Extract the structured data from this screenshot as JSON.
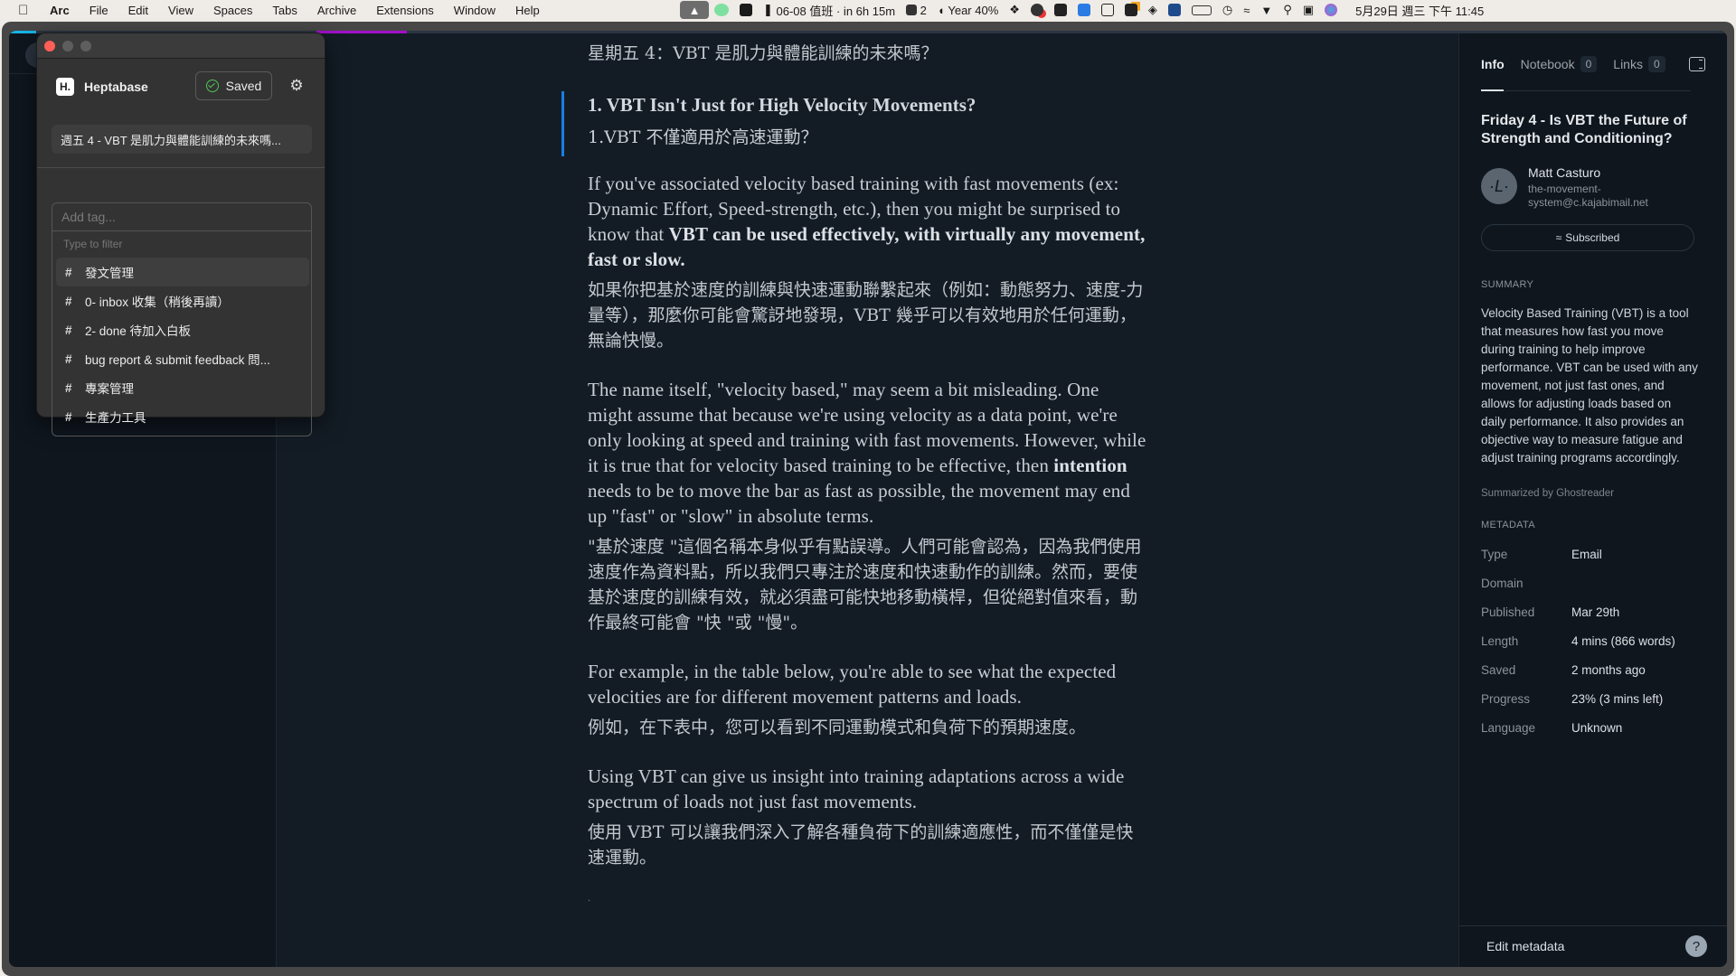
{
  "menubar": {
    "apple_icon": "apple-logo-icon",
    "app_name": "Arc",
    "menus": [
      "File",
      "Edit",
      "View",
      "Spaces",
      "Tabs",
      "Archive",
      "Extensions",
      "Window",
      "Help"
    ],
    "tray": {
      "event": "06-08 值班 · in 6h 15m",
      "todo_count": "2",
      "year_progress": "Year 40%",
      "datetime": "5月29日 週三 下午 11:45"
    }
  },
  "popup": {
    "app_name": "Heptabase",
    "logo_text": "H.",
    "saved_label": "Saved",
    "doc_title": "週五 4 - VBT 是肌力與體能訓練的未來嗎...",
    "tag_input_placeholder": "Add tag...",
    "filter_hint": "Type to filter",
    "tags": [
      "發文管理",
      "0- inbox 收集（稍後再讀）",
      "2- done 待加入白板",
      "bug report & submit feedback 問...",
      "專案管理",
      "生產力工具"
    ]
  },
  "article": {
    "title_zh": "星期五 4：VBT 是肌力與體能訓練的未來嗎？",
    "heading_en": "1. VBT Isn't Just for High Velocity Movements?",
    "heading_zh": "1.VBT 不僅適用於高速運動？",
    "p1_en_a": "If you've associated velocity based training with fast movements (ex: Dynamic Effort, Speed-strength, etc.), then you might be surprised to know that ",
    "p1_en_bold": "VBT can be used effectively, with virtually any movement, fast or slow.",
    "p1_zh": "如果你把基於速度的訓練與快速運動聯繫起來（例如：動態努力、速度-力量等），那麼你可能會驚訝地發現，VBT 幾乎可以有效地用於任何運動，無論快慢。",
    "p2_en_a": "The name itself, \"velocity based,\" may seem a bit misleading. One might assume that because we're using velocity as a data point, we're only looking at speed and training with fast movements. However, while it is true that for velocity based training to be effective, then ",
    "p2_en_bold": "intention",
    "p2_en_b": " needs to be to move the bar as fast as possible, the movement may end up \"fast\" or \"slow\" in absolute terms.",
    "p2_zh": "\"基於速度 \"這個名稱本身似乎有點誤導。人們可能會認為，因為我們使用速度作為資料點，所以我們只專注於速度和快速動作的訓練。然而，要使基於速度的訓練有效，就必須盡可能快地移動橫桿，但從絕對值來看，動作最終可能會 \"快 \"或 \"慢\"。",
    "p3_en": "For example, in the table below, you're able to see what the expected velocities are for different movement patterns and loads.",
    "p3_zh": "例如，在下表中，您可以看到不同運動模式和負荷下的預期速度。",
    "p4_en": "Using VBT can give us insight into training adaptations across a wide spectrum of loads not just fast movements.",
    "p4_zh": "使用 VBT 可以讓我們深入了解各種負荷下的訓練適應性，而不僅僅是快速運動。",
    "trailing": "."
  },
  "right_panel": {
    "tabs": [
      {
        "label": "Info",
        "count": null
      },
      {
        "label": "Notebook",
        "count": "0"
      },
      {
        "label": "Links",
        "count": "0"
      }
    ],
    "title": "Friday 4 - Is VBT the Future of Strength and Conditioning?",
    "author_name": "Matt Casturo",
    "author_email": "the-movement-system@c.kajabimail.net",
    "avatar_glyph": "·L·",
    "subscribed_label": "Subscribed",
    "summary_label": "SUMMARY",
    "summary": "Velocity Based Training (VBT) is a tool that measures how fast you move during training to help improve performance. VBT can be used with any movement, not just fast ones, and allows for adjusting loads based on daily performance. It also provides an objective way to measure fatigue and adjust training programs accordingly.",
    "summary_by": "Summarized by Ghostreader",
    "metadata_label": "METADATA",
    "metadata": [
      {
        "key": "Type",
        "value": "Email"
      },
      {
        "key": "Domain",
        "value": ""
      },
      {
        "key": "Published",
        "value": "Mar 29th"
      },
      {
        "key": "Length",
        "value": "4 mins (866 words)"
      },
      {
        "key": "Saved",
        "value": "2 months ago"
      },
      {
        "key": "Progress",
        "value": "23% (3 mins left)"
      },
      {
        "key": "Language",
        "value": "Unknown"
      }
    ],
    "edit_metadata": "Edit metadata",
    "help_glyph": "?"
  },
  "colors": {
    "accent_blue": "#1a7fe6",
    "progress_cyan": "#17b5e6",
    "progress_purple": "#a20fc9",
    "saved_green": "#4fc45a",
    "close_red": "#fe5f57"
  }
}
